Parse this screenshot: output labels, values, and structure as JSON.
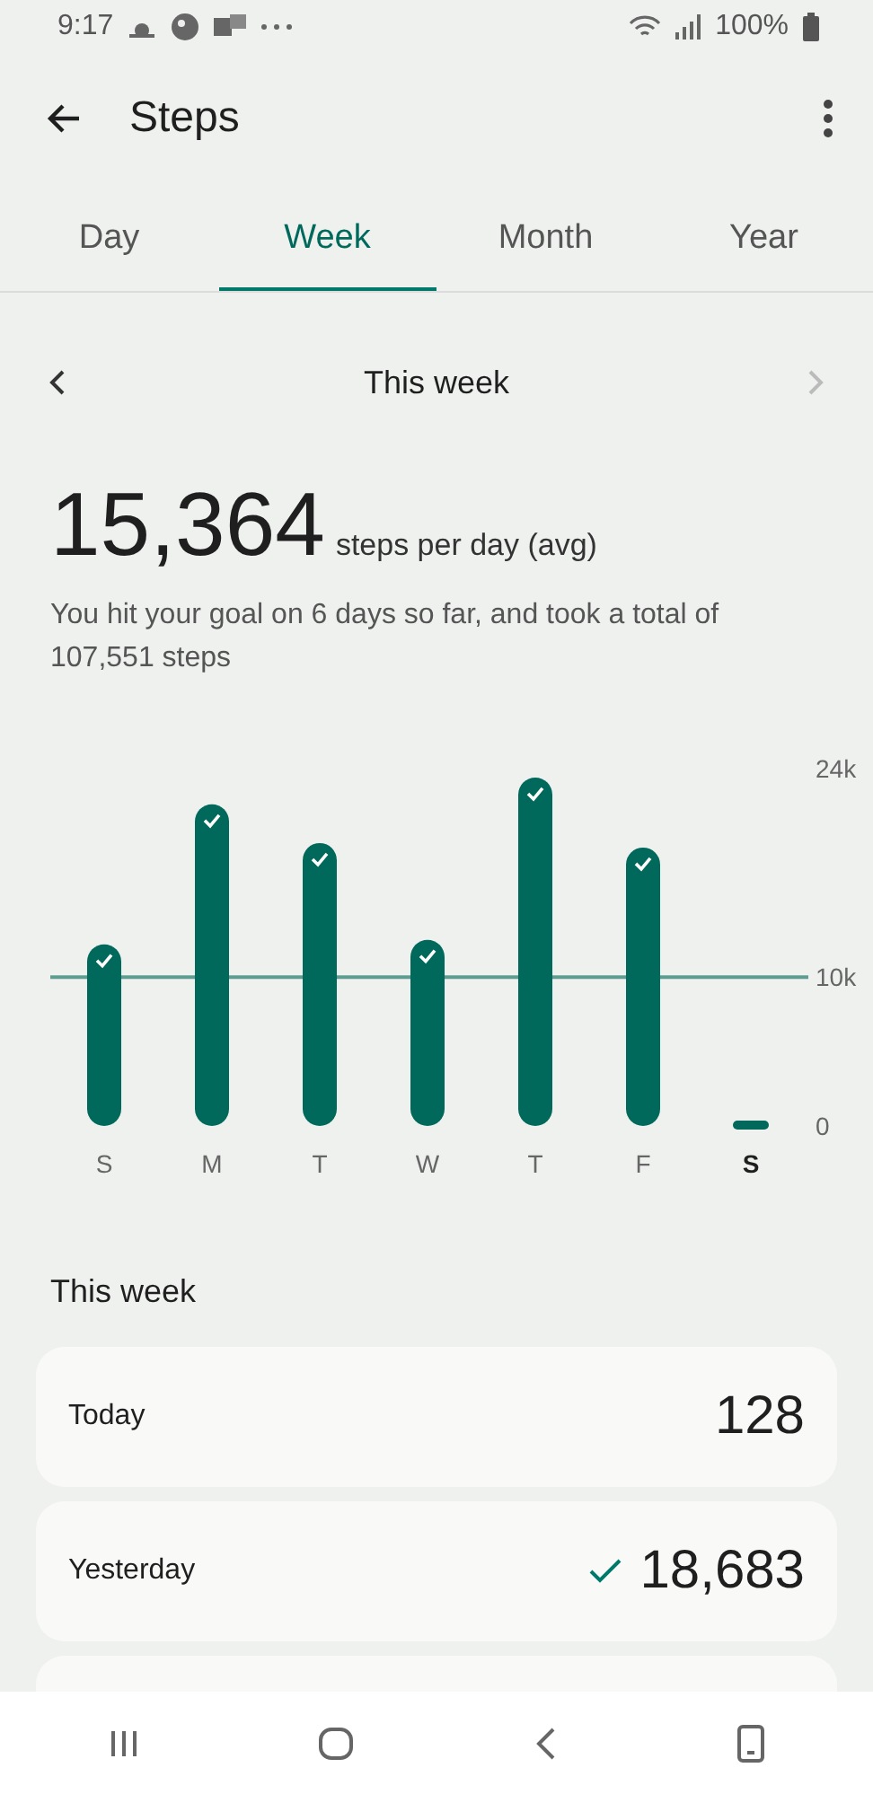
{
  "status_bar": {
    "time": "9:17",
    "battery": "100%"
  },
  "header": {
    "title": "Steps"
  },
  "tabs": [
    {
      "label": "Day",
      "selected": false
    },
    {
      "label": "Week",
      "selected": true
    },
    {
      "label": "Month",
      "selected": false
    },
    {
      "label": "Year",
      "selected": false
    }
  ],
  "period": {
    "label": "This week",
    "next_disabled": true
  },
  "summary": {
    "value": "15,364",
    "unit": "steps per day (avg)",
    "description": "You hit your goal on 6 days so far, and took a total of 107,551 steps"
  },
  "chart_data": {
    "type": "bar",
    "categories": [
      "S",
      "M",
      "T",
      "W",
      "T",
      "F",
      "S"
    ],
    "series": [
      {
        "color": "#00695c",
        "values": [
          12200,
          21600,
          19000,
          12500,
          23400,
          18700,
          100
        ]
      }
    ],
    "ylim": [
      0,
      24000
    ],
    "yticks": [
      0,
      {
        "value": 10000,
        "label": "10k"
      },
      {
        "value": 24000,
        "label": "24k"
      }
    ],
    "ref_lines": [
      {
        "axis": "y",
        "value": 10000
      }
    ]
  },
  "days": [
    {
      "selected": false
    },
    {
      "selected": false
    },
    {
      "selected": false
    },
    {
      "selected": false
    },
    {
      "selected": false
    },
    {
      "selected": false
    },
    {
      "selected": true
    }
  ],
  "section_title": "This week",
  "rows": [
    {
      "label": "Today",
      "value": "128",
      "goal_met": false
    },
    {
      "label": "Yesterday",
      "value": "18,683",
      "goal_met": true
    }
  ]
}
